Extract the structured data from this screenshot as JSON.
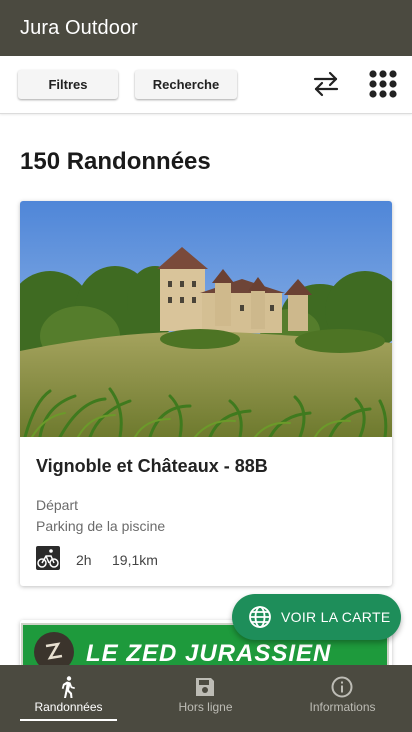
{
  "app": {
    "title": "Jura Outdoor"
  },
  "toolbar": {
    "filters_label": "Filtres",
    "search_label": "Recherche",
    "swap_icon": "swap-arrows-icon",
    "grid_icon": "apps-grid-icon"
  },
  "results": {
    "count_label": "150 Randonnées"
  },
  "hikes": [
    {
      "name": "Vignoble et Châteaux - 88B",
      "departure_label": "Départ",
      "departure_value": "Parking de la piscine",
      "activity_icon": "mountain-bike-icon",
      "duration": "2h",
      "distance": "19,1km"
    },
    {
      "banner_text": "LE ZED JURASSIEN"
    }
  ],
  "fab": {
    "label": "VOIR LA CARTE",
    "icon": "globe-icon"
  },
  "bottom_nav": {
    "items": [
      {
        "label": "Randonnées",
        "icon": "hiker-icon",
        "active": true
      },
      {
        "label": "Hors ligne",
        "icon": "save-icon",
        "active": false
      },
      {
        "label": "Informations",
        "icon": "info-icon",
        "active": false
      }
    ]
  },
  "colors": {
    "app_bar": "#4b4a40",
    "fab": "#1e8e5a",
    "banner_green": "#1e9a3c"
  }
}
